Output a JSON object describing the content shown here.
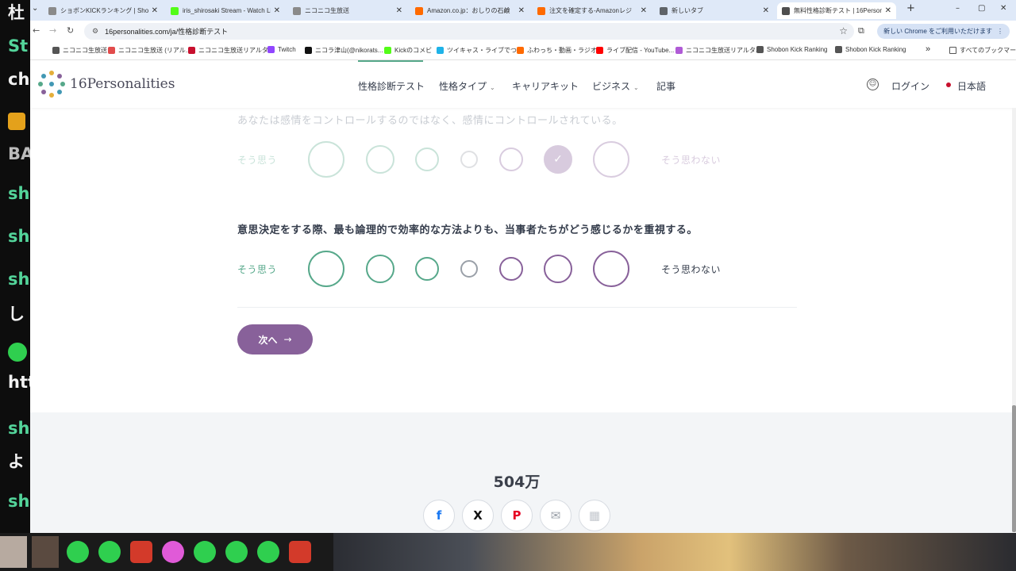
{
  "stream_overlay": {
    "left_labels": [
      "杜",
      "St",
      "ch",
      "BA",
      "sh",
      "sh",
      "sh",
      "し",
      "htt",
      "sh",
      "よ",
      "sh"
    ]
  },
  "browser": {
    "tabs": [
      {
        "title": "ショボンKICKランキング | Shobon Ki",
        "active": false
      },
      {
        "title": "iris_shirosaki Stream - Watch Li",
        "active": false
      },
      {
        "title": "ニコニコ生放送",
        "active": false
      },
      {
        "title": "Amazon.co.jp：おしりの石鹸",
        "active": false
      },
      {
        "title": "注文を確定する-Amazonレジ",
        "active": false
      },
      {
        "title": "新しいタブ",
        "active": false
      },
      {
        "title": "無料性格診断テスト | 16Personali",
        "active": true
      }
    ],
    "new_tab": "+",
    "url": "16personalities.com/ja/性格診断テスト",
    "chrome_promo": "新しい Chrome をご利用いただけます",
    "bookmarks": [
      "ニコニコ生放送",
      "ニコニコ生放送 (リアル...",
      "ニコニコ生放送リアルタ...",
      "Twitch",
      "ニコラ津山(@nikorats...",
      "Kickのコメビ",
      "ツイキャス・ライブでつ...",
      "ふわっち・動画・ラジオ...",
      "ライブ配信 - YouTube...",
      "ニコニコ生放送リアルタ...",
      "Shobon Kick Ranking",
      "Shobon Kick Ranking"
    ],
    "bookmarks_more": "»",
    "all_bookmarks": "すべてのブックマーク"
  },
  "site": {
    "logo_text": "16Personalities",
    "nav": [
      {
        "label": "性格診断テスト",
        "caret": false
      },
      {
        "label": "性格タイプ",
        "caret": true
      },
      {
        "label": "キャリアキット",
        "caret": false
      },
      {
        "label": "ビジネス",
        "caret": true
      },
      {
        "label": "記事",
        "caret": false
      }
    ],
    "login": "ログイン",
    "language": "日本語"
  },
  "test": {
    "prev_question": "あなたは感情をコントロールするのではなく、感情にコントロールされている。",
    "prev_answer_index": 5,
    "current_question": "意思決定をする際、最も論理的で効率的な方法よりも、当事者たちがどう感じるかを重視する。",
    "agree_label": "そう思う",
    "disagree_label": "そう思わない",
    "next_button": "次へ",
    "next_arrow": "→"
  },
  "footer": {
    "count": "504万",
    "share_icons": [
      "facebook-icon",
      "x-icon",
      "pinterest-icon",
      "email-icon",
      "qr-code-icon"
    ]
  },
  "colors": {
    "agree": "#56a88a",
    "disagree": "#88619a",
    "neutral": "#9aa0a8",
    "accent_purple": "#88619a"
  }
}
